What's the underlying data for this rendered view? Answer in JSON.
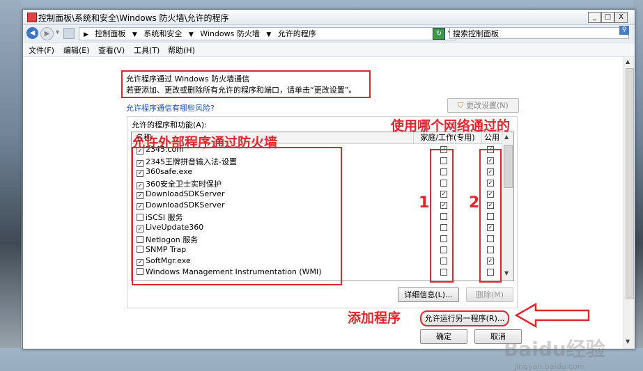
{
  "window": {
    "title": "控制面板\\系统和安全\\Windows 防火墙\\允许的程序",
    "min_label": "_",
    "max_label": "□",
    "close_label": "X"
  },
  "address": {
    "crumbs": [
      "控制面板",
      "系统和安全",
      "Windows 防火墙",
      "允许的程序"
    ],
    "search_placeholder": "搜索控制面板"
  },
  "menu": [
    "文件(F)",
    "编辑(E)",
    "查看(V)",
    "工具(T)",
    "帮助(H)"
  ],
  "page": {
    "heading": "允许程序通过 Windows 防火墙通信",
    "subheading": "若要添加、更改或删除所有允许的程序和端口，请单击“更改设置”。",
    "risk_link": "允许程序通信有哪些风险?",
    "change_settings": "更改设置(N)",
    "group_label": "允许的程序和功能(A):",
    "columns": {
      "name": "名称",
      "home": "家庭/工作(专用)",
      "public": "公用"
    }
  },
  "programs": [
    {
      "name": "2345.com",
      "checked": true,
      "home": true,
      "public": true
    },
    {
      "name": "2345王牌拼音输入法-设置",
      "checked": true,
      "home": false,
      "public": true
    },
    {
      "name": "360safe.exe",
      "checked": true,
      "home": false,
      "public": true
    },
    {
      "name": "360安全卫士实时保护",
      "checked": true,
      "home": false,
      "public": true
    },
    {
      "name": "DownloadSDKServer",
      "checked": true,
      "home": true,
      "public": true
    },
    {
      "name": "DownloadSDKServer",
      "checked": true,
      "home": true,
      "public": true
    },
    {
      "name": "iSCSI 服务",
      "checked": false,
      "home": false,
      "public": false
    },
    {
      "name": "LiveUpdate360",
      "checked": true,
      "home": false,
      "public": true
    },
    {
      "name": "Netlogon 服务",
      "checked": false,
      "home": false,
      "public": false
    },
    {
      "name": "SNMP Trap",
      "checked": false,
      "home": false,
      "public": false
    },
    {
      "name": "SoftMgr.exe",
      "checked": true,
      "home": false,
      "public": true
    },
    {
      "name": "Windows Management Instrumentation (WMI)",
      "checked": false,
      "home": false,
      "public": false
    }
  ],
  "buttons": {
    "details": "详细信息(L)...",
    "remove": "删除(M)",
    "allow_another": "允许运行另一程序(R)...",
    "ok": "确定",
    "cancel": "取消"
  },
  "annotations": {
    "outside_programs": "允许外部程序通过防火墙",
    "which_network": "使用哪个网络通过的",
    "num1": "1",
    "num2": "2",
    "add_program": "添加程序"
  },
  "watermark": {
    "main": "Baidu经验",
    "sub": "jingyan.baidu.com"
  },
  "colors": {
    "annotation_red": "#e3262d",
    "link_blue": "#1a4fb8"
  }
}
